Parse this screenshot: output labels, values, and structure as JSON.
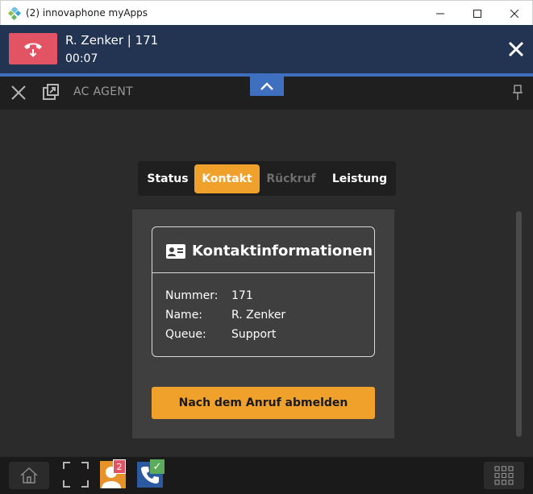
{
  "window": {
    "title": "(2) innovaphone myApps"
  },
  "call": {
    "caller": "R. Zenker | 171",
    "duration": "00:07"
  },
  "app": {
    "title": "AC AGENT"
  },
  "tabs": [
    {
      "label": "Status",
      "active": false,
      "enabled": true
    },
    {
      "label": "Kontakt",
      "active": true,
      "enabled": true
    },
    {
      "label": "Rückruf",
      "active": false,
      "enabled": false
    },
    {
      "label": "Leistung",
      "active": false,
      "enabled": true
    }
  ],
  "contact": {
    "heading": "Kontaktinformationen",
    "rows": [
      {
        "label": "Nummer:",
        "value": "171"
      },
      {
        "label": "Name:",
        "value": "R. Zenker"
      },
      {
        "label": "Queue:",
        "value": "Support"
      }
    ]
  },
  "actions": {
    "logout_after_call": "Nach dem Anruf abmelden"
  },
  "taskbar": {
    "contacts_badge": "2",
    "phone_status": "✓"
  },
  "colors": {
    "accent": "#f0a12c",
    "call_bar": "#233453",
    "hangup": "#e25463",
    "highlight_blue": "#3f6fbf"
  }
}
